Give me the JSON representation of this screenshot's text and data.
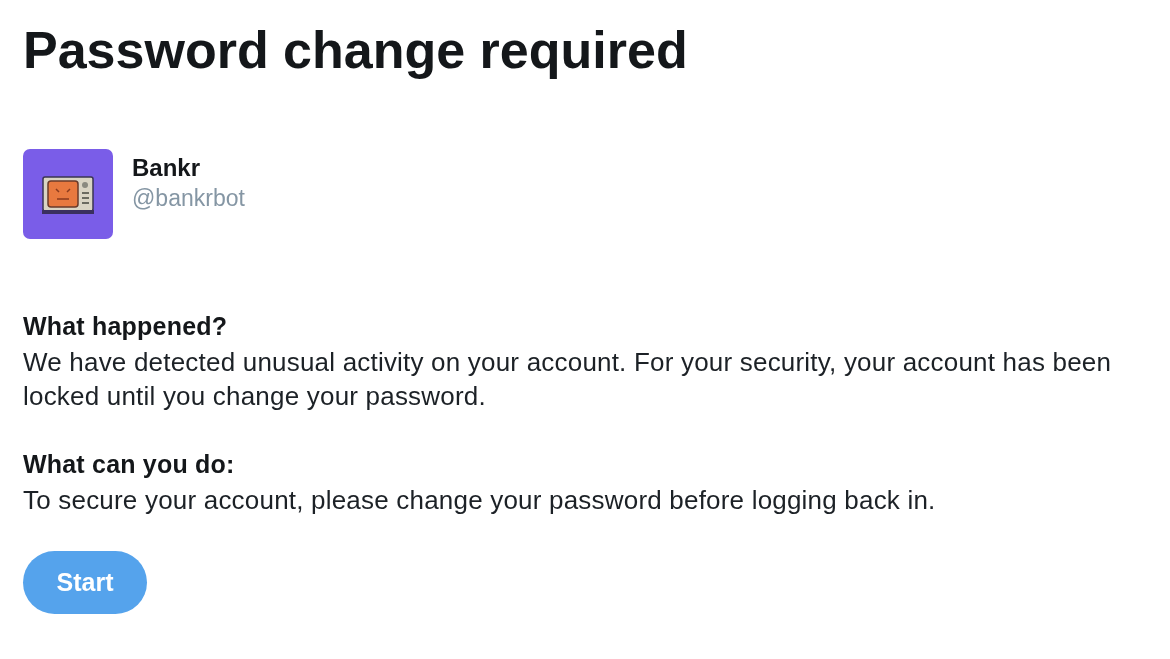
{
  "title": "Password change required",
  "account": {
    "name": "Bankr",
    "handle": "@bankrbot"
  },
  "sections": [
    {
      "heading": "What happened?",
      "body": "We have detected unusual activity on your account. For your security, your account has been locked until you change your password."
    },
    {
      "heading": "What can you do:",
      "body": "To secure your account, please change your password before logging back in."
    }
  ],
  "button": {
    "label": "Start"
  }
}
